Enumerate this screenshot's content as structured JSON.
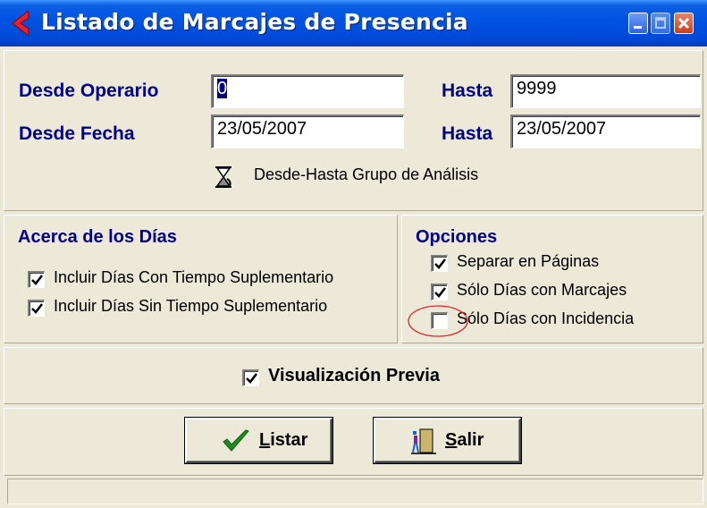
{
  "window": {
    "title": "Listado de Marcajes de Presencia"
  },
  "filters": {
    "operario_label": "Desde Operario",
    "operario_from": "0",
    "operario_to_label": "Hasta",
    "operario_to": "9999",
    "fecha_label": "Desde Fecha",
    "fecha_from": "23/05/2007",
    "fecha_to_label": "Hasta",
    "fecha_to": "23/05/2007",
    "grupo_label": "Desde-Hasta Grupo de Análisis"
  },
  "days": {
    "title": "Acerca de los Días",
    "items": [
      {
        "label": "Incluir Días Con Tiempo Suplementario",
        "checked": true
      },
      {
        "label": "Incluir Días Sin Tiempo Suplementario",
        "checked": true
      }
    ]
  },
  "options": {
    "title": "Opciones",
    "items": [
      {
        "label": "Separar en Páginas",
        "checked": true
      },
      {
        "label": "Sólo Días con Marcajes",
        "checked": true
      },
      {
        "label": "Sólo Días con Incidencia",
        "checked": false
      }
    ]
  },
  "preview": {
    "label": "Visualización Previa",
    "checked": true
  },
  "buttons": {
    "listar": {
      "hotkey": "L",
      "rest": "istar",
      "icon": "checkmark-icon"
    },
    "salir": {
      "hotkey": "S",
      "rest": "alir",
      "icon": "exit-door-icon"
    }
  },
  "colors": {
    "label_blue": "#00008b",
    "titlebar": "#0054e3",
    "annotation_circle": "#e8202a"
  }
}
